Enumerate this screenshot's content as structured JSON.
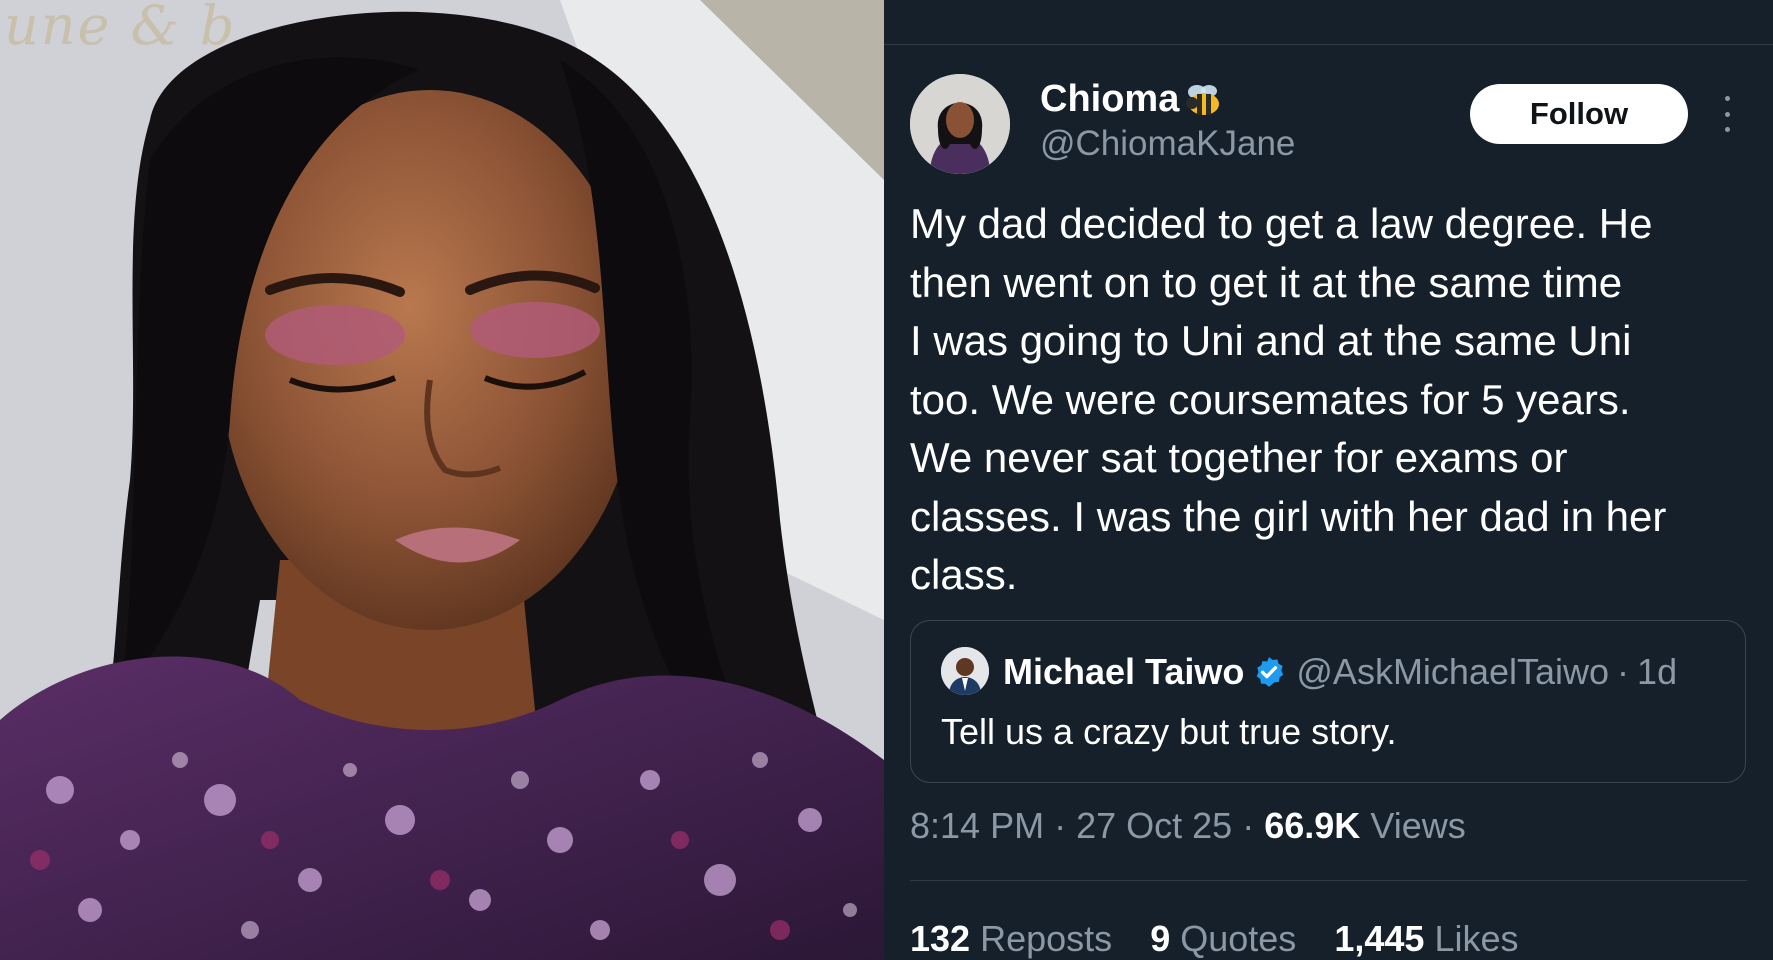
{
  "photo": {
    "watermark": "une & b"
  },
  "tweet": {
    "display_name": "Chioma",
    "name_emoji_icon": "bee-icon",
    "handle": "@ChiomaKJane",
    "follow_label": "Follow",
    "more_icon": "more-vertical-icon",
    "text": "My dad decided to get a law degree. He\nthen went on to get it at the same time\nI was going to Uni and at the same Uni\ntoo. We were coursemates for 5 years.\nWe never sat together for exams or\nclasses. I was the girl with her dad in her\nclass.",
    "quote": {
      "name": "Michael Taiwo",
      "verified_icon": "verified-badge-icon",
      "handle": "@AskMichaelTaiwo",
      "separator": "·",
      "age": "1d",
      "text": "Tell us a crazy but true story."
    },
    "meta": {
      "time": "8:14 PM",
      "sep": "·",
      "date": "27 Oct 25",
      "views_count": "66.9K",
      "views_label": "Views"
    },
    "stats": {
      "reposts_count": "132",
      "reposts_label": "Reposts",
      "quotes_count": "9",
      "quotes_label": "Quotes",
      "likes_count": "1,445",
      "likes_label": "Likes"
    }
  },
  "colors": {
    "background": "#15202b",
    "secondary_text": "#8b98a5",
    "divider": "#2f3b47",
    "verified": "#1d9bf0",
    "follow_bg": "#ffffff"
  }
}
